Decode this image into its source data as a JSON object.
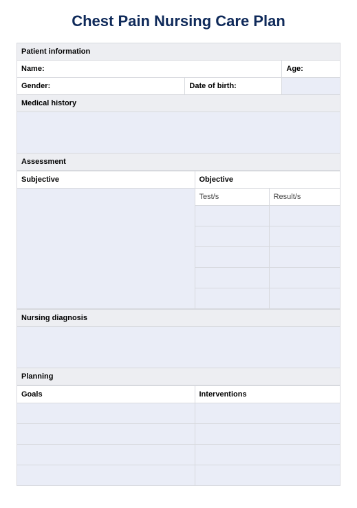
{
  "title": "Chest Pain Nursing Care Plan",
  "patient_info": {
    "section_label": "Patient information",
    "name_label": "Name:",
    "age_label": "Age:",
    "gender_label": "Gender:",
    "dob_label": "Date of birth:",
    "medical_history_label": "Medical history"
  },
  "assessment": {
    "section_label": "Assessment",
    "subjective_label": "Subjective",
    "objective_label": "Objective",
    "tests_col": "Test/s",
    "results_col": "Result/s"
  },
  "nursing_diagnosis": {
    "section_label": "Nursing diagnosis"
  },
  "planning": {
    "section_label": "Planning",
    "goals_label": "Goals",
    "interventions_label": "Interventions"
  }
}
